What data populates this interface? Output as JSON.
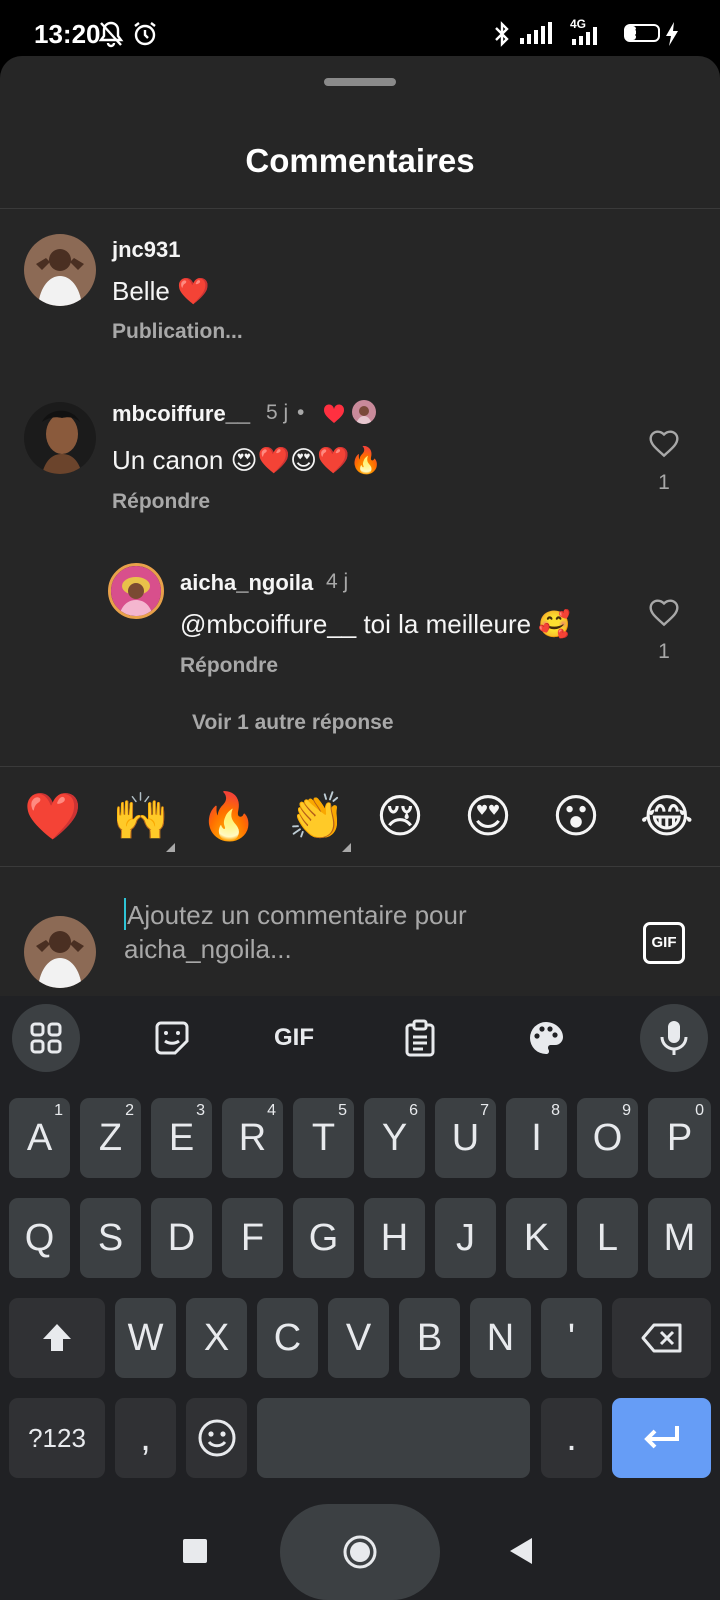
{
  "status_bar": {
    "time": "13:20",
    "network": "4G",
    "battery_level": "31",
    "icons": [
      "bell-off-icon",
      "alarm-icon",
      "bluetooth-icon",
      "signal-icon",
      "signal-4g-icon",
      "battery-icon",
      "charging-icon"
    ]
  },
  "sheet": {
    "title": "Commentaires"
  },
  "comments": [
    {
      "username": "jnc931",
      "text": "Belle ❤️",
      "sublabel": "Publication..."
    },
    {
      "username": "mbcoiffure__",
      "time": "5 j",
      "separator": "•",
      "text": "Un canon 😍❤️😍❤️🔥",
      "reply_label": "Répondre",
      "like_count": "1"
    },
    {
      "username": "aicha_ngoila",
      "time": "4 j",
      "text": "@mbcoiffure__ toi la meilleure 🥰",
      "reply_label": "Répondre",
      "like_count": "1"
    }
  ],
  "more_replies": "Voir 1 autre réponse",
  "quick_emojis": [
    "❤️",
    "🙌",
    "🔥",
    "👏",
    "😢",
    "😍",
    "😮",
    "😂"
  ],
  "composer": {
    "placeholder": "Ajoutez un commentaire pour aicha_ngoila...",
    "gif_label": "GIF"
  },
  "keyboard": {
    "toolbar": [
      "apps-grid-icon",
      "sticker-icon",
      "gif-icon",
      "clipboard-icon",
      "palette-icon",
      "microphone-icon"
    ],
    "toolbar_gif": "GIF",
    "row1": [
      "A",
      "Z",
      "E",
      "R",
      "T",
      "Y",
      "U",
      "I",
      "O",
      "P"
    ],
    "row1_hints": [
      "1",
      "2",
      "3",
      "4",
      "5",
      "6",
      "7",
      "8",
      "9",
      "0"
    ],
    "row2": [
      "Q",
      "S",
      "D",
      "F",
      "G",
      "H",
      "J",
      "K",
      "L",
      "M"
    ],
    "row3": [
      "W",
      "X",
      "C",
      "V",
      "B",
      "N",
      "'"
    ],
    "symbols": "?123",
    "comma": ",",
    "period": "."
  },
  "colors": {
    "sheet_bg": "#262626",
    "keyboard_bg": "#202124",
    "key_bg": "#3c4043",
    "enter_key": "#669df6",
    "like_heart": "#ff3040"
  }
}
